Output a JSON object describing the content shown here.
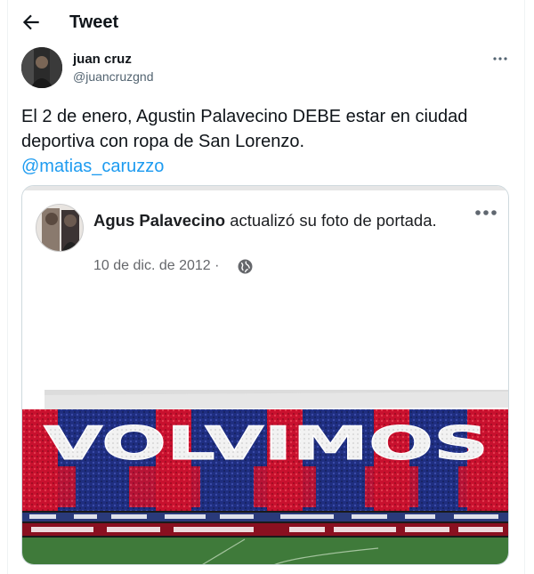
{
  "header": {
    "title": "Tweet"
  },
  "tweet": {
    "author_name": "juan cruz",
    "author_handle": "@juancruzgnd",
    "text_part1": "El 2 de enero, Agustin Palavecino DEBE estar en ciudad deportiva con ropa de San Lorenzo.",
    "mention": "@matias_caruzzo"
  },
  "card": {
    "name": "Agus Palavecino",
    "action": " actualizó su foto de portada.",
    "date": "10 de dic. de 2012 ·",
    "banner_text": "VOLVIMOS"
  },
  "colors": {
    "accent": "#1d9bf0",
    "red": "#c8102e",
    "blue": "#1b2a78"
  }
}
